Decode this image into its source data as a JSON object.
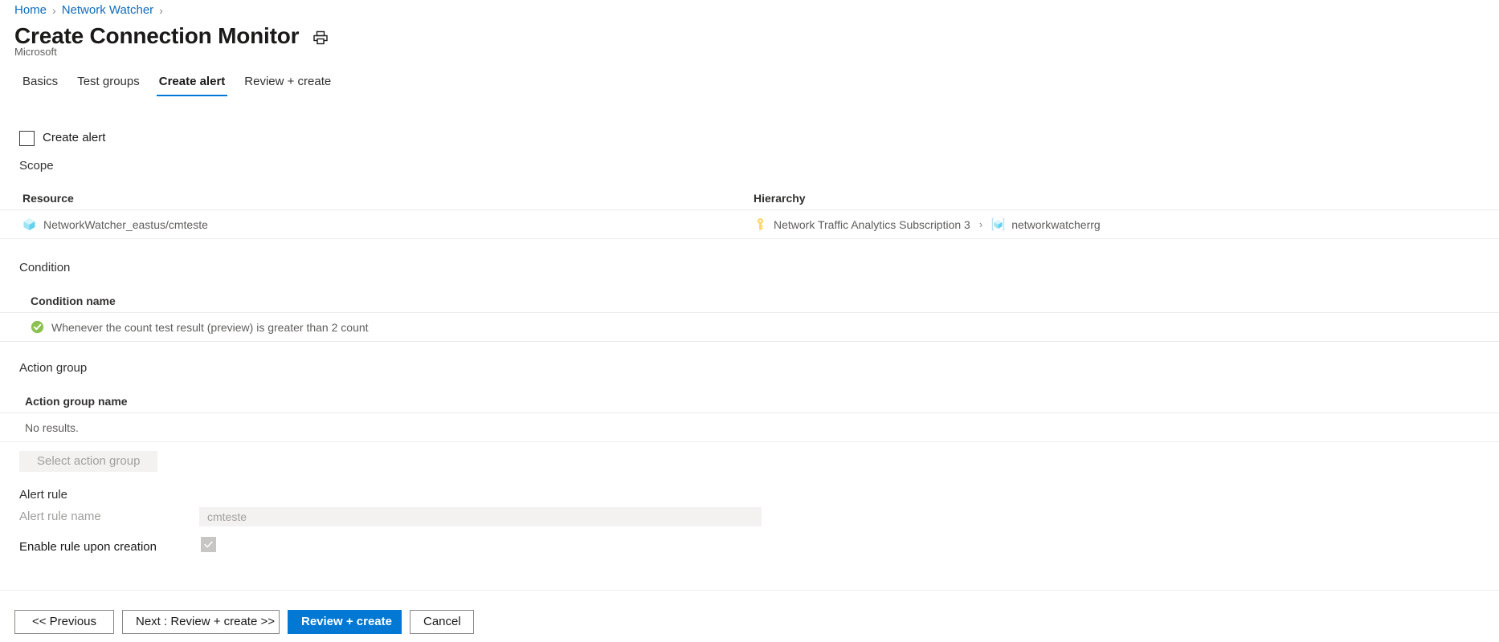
{
  "breadcrumb": {
    "items": [
      {
        "label": "Home"
      },
      {
        "label": "Network Watcher"
      }
    ],
    "separator": "›"
  },
  "header": {
    "title": "Create Connection Monitor",
    "subtitle": "Microsoft",
    "print_icon": "print-icon"
  },
  "tabs": [
    {
      "label": "Basics",
      "active": false
    },
    {
      "label": "Test groups",
      "active": false
    },
    {
      "label": "Create alert",
      "active": true
    },
    {
      "label": "Review + create",
      "active": false
    }
  ],
  "create_alert": {
    "label": "Create alert",
    "checked": false
  },
  "scope": {
    "heading": "Scope",
    "columns": {
      "resource": "Resource",
      "hierarchy": "Hierarchy"
    },
    "rows": [
      {
        "resource_icon": "resource-cube-icon",
        "resource": "NetworkWatcher_eastus/cmteste",
        "hierarchy": [
          {
            "icon": "subscription-key-icon",
            "label": "Network Traffic Analytics Subscription 3"
          },
          {
            "icon": "resource-group-icon",
            "label": "networkwatcherrg"
          }
        ],
        "hierarchy_separator": "›"
      }
    ]
  },
  "condition": {
    "heading": "Condition",
    "column": "Condition name",
    "rows": [
      {
        "status_icon": "success-check-icon",
        "label": "Whenever the count test result (preview) is greater than 2 count"
      }
    ]
  },
  "action_group": {
    "heading": "Action group",
    "column": "Action group name",
    "empty_text": "No results.",
    "select_button": "Select action group"
  },
  "alert_rule": {
    "heading": "Alert rule",
    "name_label": "Alert rule name",
    "name_value": "cmteste",
    "name_placeholder": "",
    "enable_label": "Enable rule upon creation",
    "enable_checked": true
  },
  "footer": {
    "previous": "<< Previous",
    "next": "Next : Review + create >>",
    "review_create": "Review + create",
    "cancel": "Cancel"
  },
  "colors": {
    "accent": "#0078d4",
    "link": "#0f6cbd",
    "success": "#8cc152",
    "divider": "#edebe9",
    "disabled_bg": "#f3f2f1",
    "disabled_text": "#a19f9d"
  }
}
